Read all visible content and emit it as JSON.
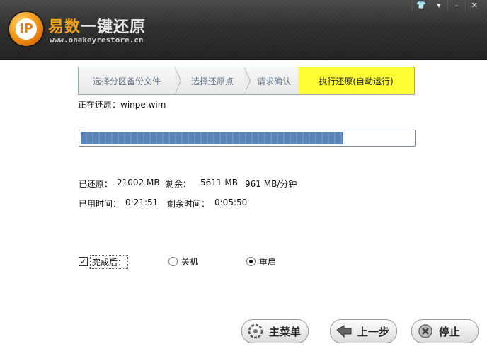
{
  "header": {
    "title_brand": "易数",
    "title_rest": "一键还原",
    "url": "www.onekeyrestore.cn",
    "logo_glyph": "iP",
    "window_buttons": [
      "shirt-icon",
      "menu-icon",
      "minimize-icon",
      "close-icon"
    ]
  },
  "wizard": {
    "steps": [
      {
        "label": "选择分区备份文件"
      },
      {
        "label": "选择还原点"
      },
      {
        "label": "请求确认"
      },
      {
        "label": "执行还原(自动运行)"
      }
    ],
    "active_index": 3
  },
  "status": {
    "restoring_label": "正在还原：",
    "restoring_file": "winpe.wim",
    "progress_fraction": 0.79
  },
  "stats": {
    "restored_label": "已还原：",
    "restored_value": "21002 MB",
    "remaining_label": "剩余：",
    "remaining_value": "5611 MB",
    "speed_value": "961 MB/分钟",
    "elapsed_label": "已用时间：",
    "elapsed_value": "0:21:51",
    "time_left_label": "剩余时间：",
    "time_left_value": "0:05:50"
  },
  "after": {
    "checkbox_label": "完成后：",
    "checked": true,
    "options": [
      {
        "label": "关机",
        "selected": false
      },
      {
        "label": "重启",
        "selected": true
      }
    ]
  },
  "buttons": {
    "main_menu": "主菜单",
    "previous": "上一步",
    "stop": "停止"
  },
  "colors": {
    "active_step": "#ffff33",
    "progress_fill": "#5a84b3",
    "brand_orange": "#f0a21a"
  }
}
